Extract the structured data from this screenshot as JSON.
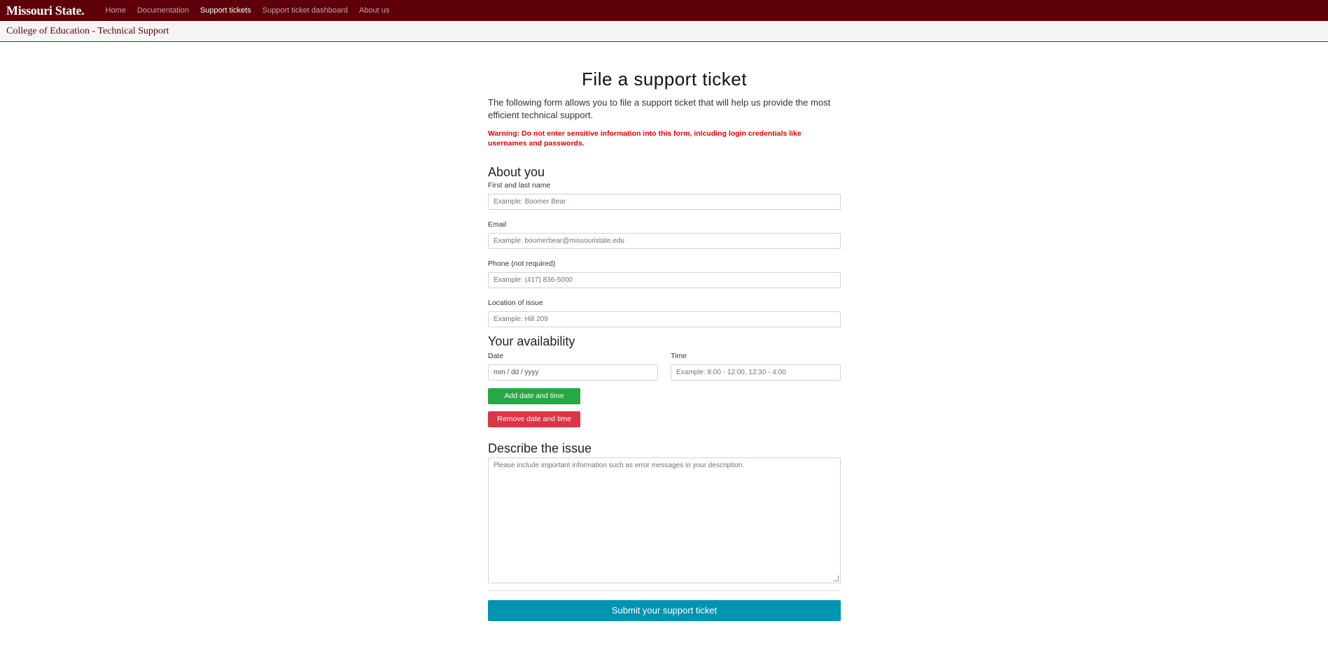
{
  "nav": {
    "brand": "Missouri State.",
    "links": [
      {
        "label": "Home",
        "active": false
      },
      {
        "label": "Documentation",
        "active": false
      },
      {
        "label": "Support tickets",
        "active": true
      },
      {
        "label": "Support ticket dashboard",
        "active": false
      },
      {
        "label": "About us",
        "active": false
      }
    ]
  },
  "subheader": {
    "title": "College of Education - Technical Support"
  },
  "page": {
    "title": "File a support ticket",
    "intro": "The following form allows you to file a support ticket that will help us provide the most efficient technical support.",
    "warning": "Warning: Do not enter sensitive information into this form, inlcuding login credentials like usernames and passwords."
  },
  "about": {
    "heading": "About you",
    "name": {
      "label": "First and last name",
      "placeholder": "Example: Boomer Bear"
    },
    "email": {
      "label": "Email",
      "placeholder": "Example: boomerbear@missouristate.edu"
    },
    "phone": {
      "label": "Phone (not required)",
      "placeholder": "Example: (417) 836-5000"
    },
    "location": {
      "label": "Location of issue",
      "placeholder": "Example: Hill 209"
    }
  },
  "availability": {
    "heading": "Your availability",
    "date": {
      "label": "Date",
      "placeholder": "mm / dd / yyyy"
    },
    "time": {
      "label": "Time",
      "placeholder": "Example: 8:00 - 12:00, 12:30 - 4:00"
    },
    "add_label": "Add date and time",
    "remove_label": "Remove date and time"
  },
  "issue": {
    "heading": "Describe the issue",
    "placeholder": "Please include important information such as error messages in your description."
  },
  "submit_label": "Submit your support ticket",
  "colors": {
    "brand": "#5e0009",
    "add": "#28a745",
    "remove": "#dc3545",
    "submit": "#0094b3",
    "warning": "#e00000"
  }
}
